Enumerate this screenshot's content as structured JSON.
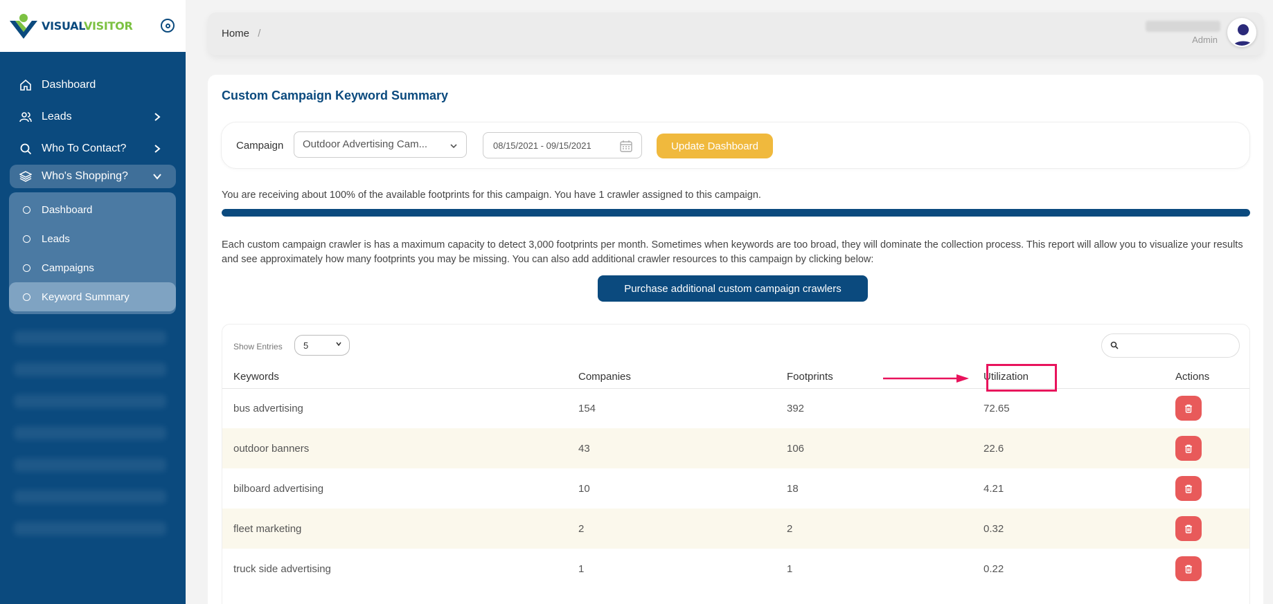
{
  "brand": {
    "part1": "VISUAL",
    "part2": "VISITOR"
  },
  "sidebar": {
    "items": [
      {
        "label": "Dashboard",
        "icon": "home-icon"
      },
      {
        "label": "Leads",
        "icon": "users-icon"
      },
      {
        "label": "Who To Contact?",
        "icon": "search-icon"
      },
      {
        "label": "Who's Shopping?",
        "icon": "layers-icon"
      }
    ],
    "subitems": [
      {
        "label": "Dashboard"
      },
      {
        "label": "Leads"
      },
      {
        "label": "Campaigns"
      },
      {
        "label": "Keyword Summary"
      }
    ]
  },
  "header": {
    "breadcrumb": "Home",
    "separator": "/",
    "user_role": "Admin"
  },
  "main": {
    "title": "Custom Campaign Keyword Summary",
    "filter": {
      "campaign_label": "Campaign",
      "campaign_value": "Outdoor Advertising Cam...",
      "date_range": "08/15/2021 - 09/15/2021",
      "update_button": "Update Dashboard"
    },
    "info_text": "You are receiving about 100% of the available footprints for this campaign. You have 1 crawler assigned to this campaign.",
    "progress_percent": 100,
    "description": "Each custom campaign crawler is has a maximum capacity to detect 3,000 footprints per month. Sometimes when keywords are too broad, they will dominate the collection process. This report will allow you to visualize your results and see approximately how many footprints you may be missing. You can also add additional crawler resources to this campaign by clicking below:",
    "purchase_button": "Purchase additional custom campaign crawlers"
  },
  "table": {
    "show_entries_label": "Show Entries",
    "entries_value": "5",
    "columns": [
      "Keywords",
      "Companies",
      "Footprints",
      "Utilization",
      "Actions"
    ],
    "rows": [
      {
        "keyword": "bus advertising",
        "companies": "154",
        "footprints": "392",
        "utilization": "72.65"
      },
      {
        "keyword": "outdoor banners",
        "companies": "43",
        "footprints": "106",
        "utilization": "22.6"
      },
      {
        "keyword": "bilboard advertising",
        "companies": "10",
        "footprints": "18",
        "utilization": "4.21"
      },
      {
        "keyword": "fleet marketing",
        "companies": "2",
        "footprints": "2",
        "utilization": "0.32"
      },
      {
        "keyword": "truck side advertising",
        "companies": "1",
        "footprints": "1",
        "utilization": "0.22"
      }
    ]
  },
  "colors": {
    "sidebar": "#0b4a7e",
    "accent_yellow": "#f0b93d",
    "delete_red": "#e85a5a",
    "highlight": "#e8135c"
  }
}
